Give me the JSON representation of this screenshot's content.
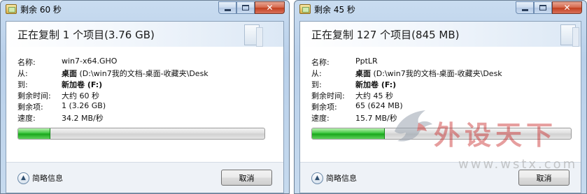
{
  "dialogs": [
    {
      "title": "剩余 60 秒",
      "header": "正在复制 1 个项目(3.76 GB)",
      "details": [
        {
          "label": "名称:",
          "value": "win7-x64.GHO"
        },
        {
          "label": "从:",
          "value_bold": "桌面",
          "value": "(D:\\win7我的文档-桌面-收藏夹\\Desk"
        },
        {
          "label": "到:",
          "value_bold": "新加卷 (F:)",
          "value": ""
        },
        {
          "label": "剩余时间:",
          "value": "大约 60 秒"
        },
        {
          "label": "剩余项:",
          "value": "1 (3.26 GB)"
        },
        {
          "label": "速度:",
          "value": "34.2 MB/秒"
        }
      ],
      "progress": 0.13,
      "more_details_label": "简略信息",
      "cancel_label": "取消",
      "controls": {
        "minimize": "",
        "maximize": "",
        "close": "✕"
      }
    },
    {
      "title": "剩余 45 秒",
      "header": "正在复制 127 个项目(845 MB)",
      "details": [
        {
          "label": "名称:",
          "value": "PptLR"
        },
        {
          "label": "从:",
          "value_bold": "桌面",
          "value": "(D:\\win7我的文档-桌面-收藏夹\\Desk"
        },
        {
          "label": "到:",
          "value_bold": "新加卷 (F:)",
          "value": ""
        },
        {
          "label": "剩余时间:",
          "value": "大约 45 秒"
        },
        {
          "label": "剩余项:",
          "value": "65 (624 MB)"
        },
        {
          "label": "速度:",
          "value": "15.7 MB/秒"
        }
      ],
      "progress": 0.28,
      "more_details_label": "简略信息",
      "cancel_label": "取消",
      "controls": {
        "minimize": "",
        "maximize": "",
        "close": "✕"
      }
    }
  ],
  "watermark": {
    "text": "外设天下",
    "url": "www.wstx.com"
  },
  "colors": {
    "progress_green": "#37c33a",
    "title_bar": "#c9dcf0",
    "close_red": "#c2401f"
  }
}
